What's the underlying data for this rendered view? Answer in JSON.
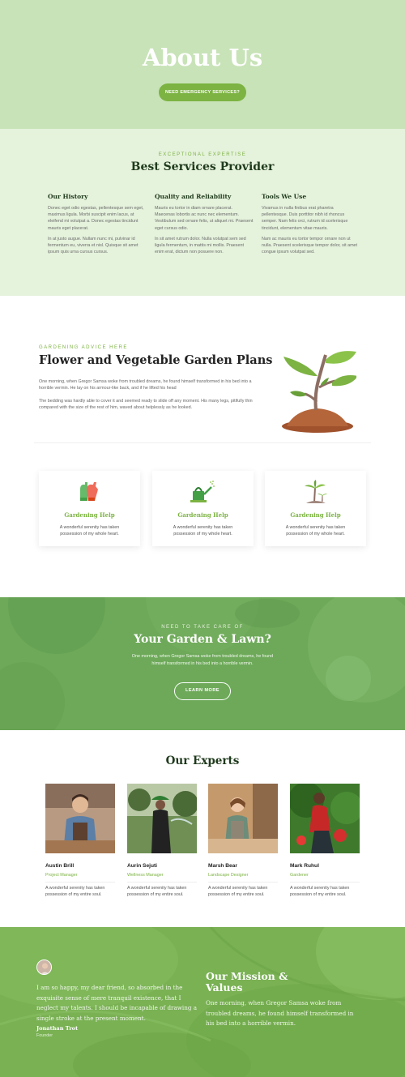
{
  "hero": {
    "title": "About Us",
    "button_label": "NEED EMERGENCY SERVICES?"
  },
  "services": {
    "eyebrow": "EXCEPTIONAL EXPERTISE",
    "title": "Best Services Provider",
    "columns": [
      {
        "title": "Our History",
        "p1": "Donec eget odio egestas, pellentesque sem eget, maximus ligula. Morbi suscipit enim lacus, at eleifend mi volutpat a. Donec egestas tincidunt mauris eget placerat.",
        "p2": "In at justo augue. Nullam nunc mi, pulvinar id fermentum eu, viverra et nisl. Quisque sit amet ipsum quis urna cursus cursus."
      },
      {
        "title": "Quality and Reliability",
        "p1": "Mauris eu tortor in diam ornare placerat. Maecenas lobortis ac nunc nec elementum. Vestibulum sed ornare felis, ut aliquet mi. Praesent eget cursus odio.",
        "p2": "In sit amet rutrum dolor. Nulla volutpat sem sed ligula fermentum, in mattis mi mollis. Praesent enim erat, dictum non posuere non."
      },
      {
        "title": "Tools We Use",
        "p1": "Vivamus in nulla finibus erat pharetra pellentesque. Duis porttitor nibh id rhoncus semper. Nam felis orci, rutrum id scelerisque tincidunt, elementum vitae mauris.",
        "p2": "Nam ac mauris eu tortor tempor ornare non ut nulla. Praesent scelerisque tempor dolor, sit amet congue ipsum volutpat sed."
      }
    ]
  },
  "plans": {
    "eyebrow": "GARDENING ADVICE HERE",
    "title": "Flower and Vegetable Garden Plans",
    "p1": "One morning, when Gregor Samsa woke from troubled dreams, he found himself transformed in his bed into a horrible vermin. He lay on his armour-like back, and if he lifted his head",
    "p2": "The bedding was hardly able to cover it and seemed ready to slide off any moment. His many legs, pitifully thin compared with the size of the rest of him, waved about helplessly as he looked."
  },
  "cards": [
    {
      "icon": "gloves-icon",
      "title": "Gardening Help",
      "desc": "A wonderful serenity has taken possession of my whole heart."
    },
    {
      "icon": "watering-can-icon",
      "title": "Gardening Help",
      "desc": "A wonderful serenity has taken possession of my whole heart."
    },
    {
      "icon": "palm-tree-icon",
      "title": "Gardening Help",
      "desc": "A wonderful serenity has taken possession of my whole heart."
    }
  ],
  "banner": {
    "eyebrow": "NEED TO TAKE CARE OF",
    "title": "Your Garden & Lawn?",
    "desc": "One morning, when Gregor Samsa woke from troubled dreams, he found himself transformed in his bed into a horrible vermin.",
    "button_label": "LEARN MORE"
  },
  "experts": {
    "title": "Our Experts",
    "people": [
      {
        "name": "Austin Brill",
        "role": "Project Manager",
        "desc": "A wonderful serenity has taken possession of my entire soul."
      },
      {
        "name": "Aurin Sejuti",
        "role": "Wellness Manager",
        "desc": "A wonderful serenity has taken possession of my entire soul."
      },
      {
        "name": "Marsh Bear",
        "role": "Landscape Designer",
        "desc": "A wonderful serenity has taken possession of my entire soul."
      },
      {
        "name": "Mark Ruhul",
        "role": "Gardener",
        "desc": "A wonderful serenity has taken possession of my entire soul."
      }
    ]
  },
  "mission": {
    "quote": "I am so happy, my dear friend, so absorbed in the exquisite sense of mere tranquil existence, that I neglect my talents. I should be incapable of drawing a single stroke at the present moment.",
    "quote_name": "Jonathan Trot",
    "quote_role": "Founder",
    "title": "Our Mission & Values",
    "desc": "One morning, when Gregor Samsa woke from troubled dreams, he found himself transformed in his bed into a horrible vermin."
  },
  "colors": {
    "accent": "#7cb342",
    "hero_bg": "#c8e3b8",
    "services_bg": "#e5f2dc",
    "dark_green": "#1f3a1c"
  }
}
